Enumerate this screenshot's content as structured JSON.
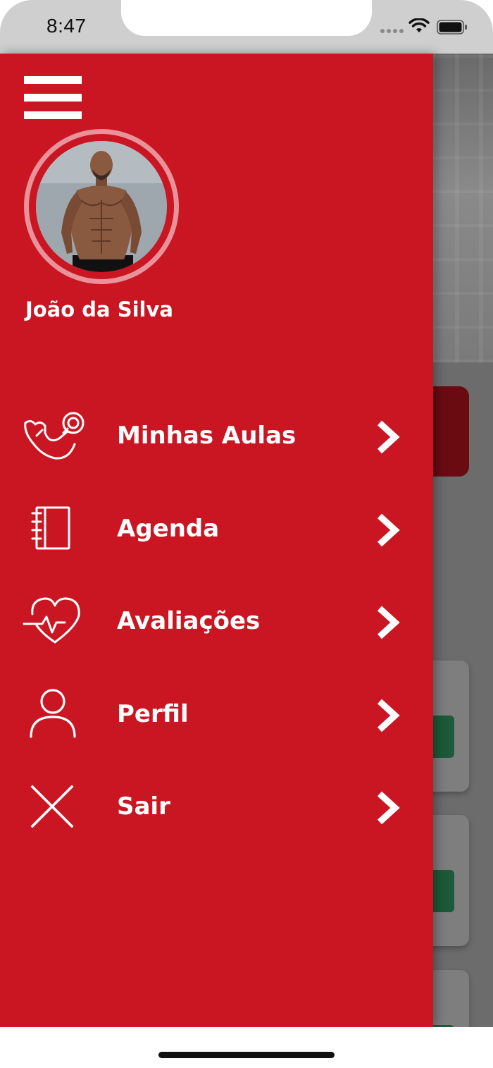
{
  "status_bar": {
    "time": "8:47"
  },
  "drawer": {
    "user_name": "João da Silva",
    "menu_items": [
      {
        "label": "Minhas Aulas",
        "icon": "flexed-arm-dumbbell-icon"
      },
      {
        "label": "Agenda",
        "icon": "notebook-icon"
      },
      {
        "label": "Avaliações",
        "icon": "heart-pulse-icon"
      },
      {
        "label": "Perfil",
        "icon": "user-icon"
      },
      {
        "label": "Sair",
        "icon": "close-icon"
      }
    ]
  },
  "colors": {
    "drawer_background": "#c91622",
    "status_bar_background": "#cfcfcf",
    "overlay_background": "#6c6c6c",
    "accent_dark_red": "#6a0b12",
    "accent_green": "#1c5a38",
    "text": "#ffffff"
  }
}
